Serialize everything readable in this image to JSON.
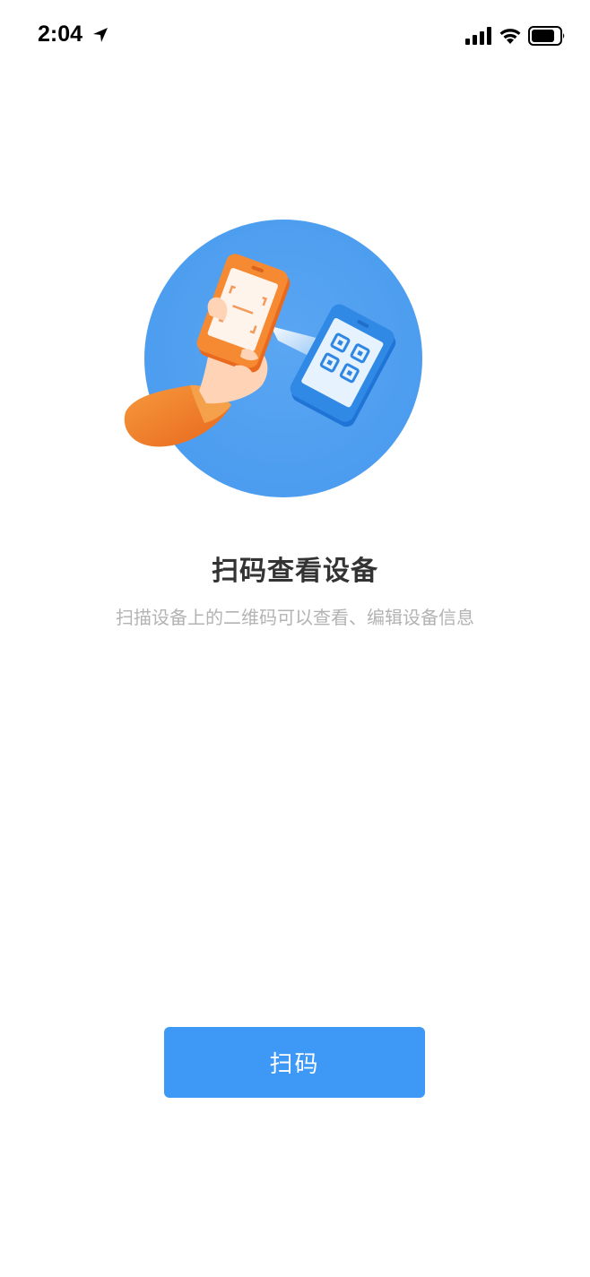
{
  "status_bar": {
    "time": "2:04",
    "icons": [
      "location-arrow-icon",
      "cellular-signal-icon",
      "wifi-icon",
      "battery-icon"
    ]
  },
  "illustration": {
    "icon": "scan-qr-code-illustration",
    "colors": {
      "circle": "#4f9ef0",
      "phone_scanner": "#f47c2a",
      "phone_target": "#2f86e3",
      "sleeve": "#f0812e"
    }
  },
  "main": {
    "title": "扫码查看设备",
    "subtitle": "扫描设备上的二维码可以查看、编辑设备信息"
  },
  "actions": {
    "scan_label": "扫码",
    "accent_color": "#3d99f5"
  }
}
